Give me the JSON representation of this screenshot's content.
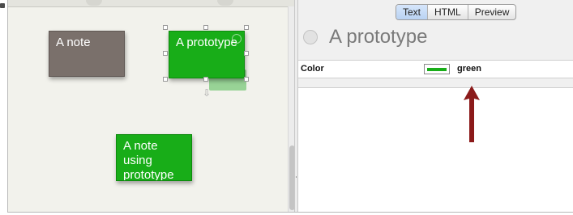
{
  "map": {
    "notes": [
      {
        "label": "A note",
        "color": "#7a706b"
      },
      {
        "label": "A prototype",
        "color": "#18ad18"
      },
      {
        "label": "A note using prototype",
        "color": "#18ad18"
      }
    ]
  },
  "editor": {
    "tabs": [
      {
        "label": "Text",
        "active": true
      },
      {
        "label": "HTML",
        "active": false
      },
      {
        "label": "Preview",
        "active": false
      }
    ],
    "note_title": "A prototype",
    "attribute": {
      "name": "Color",
      "value": "green",
      "swatch_color": "#18ad18"
    }
  },
  "annotation": {
    "arrow_color": "#8b1a1a"
  }
}
